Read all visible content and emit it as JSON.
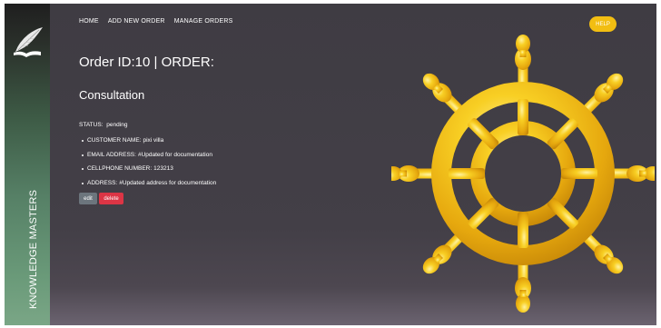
{
  "nav": {
    "home": "HOME",
    "add_order": "ADD NEW ORDER",
    "manage_orders": "MANAGE ORDERS"
  },
  "help_label": "HELP",
  "brand": "KNOWLEDGE MASTERS",
  "order": {
    "title": "Order ID:10 | ORDER:",
    "type": "Consultation",
    "status_label": "STATUS:",
    "status_value": "pending",
    "details": [
      {
        "label": "CUSTOMER NAME:",
        "value": "pixi villa"
      },
      {
        "label": "EMAIL ADDRESS:",
        "value": "#Updated for documentation"
      },
      {
        "label": "CELLPHONE NUMBER:",
        "value": "123213"
      },
      {
        "label": "ADDRESS:",
        "value": "#Updated address for documentation"
      }
    ]
  },
  "actions": {
    "edit_label": "edit",
    "delete_label": "delete"
  },
  "colors": {
    "help_button": "#f2be12",
    "edit_button": "#6c757d",
    "delete_button": "#dc3545",
    "wheel_gold": "#f5c518",
    "background": "#423e46"
  },
  "icons": {
    "logo": "quill-book-icon",
    "illustration": "ship-wheel-icon"
  }
}
